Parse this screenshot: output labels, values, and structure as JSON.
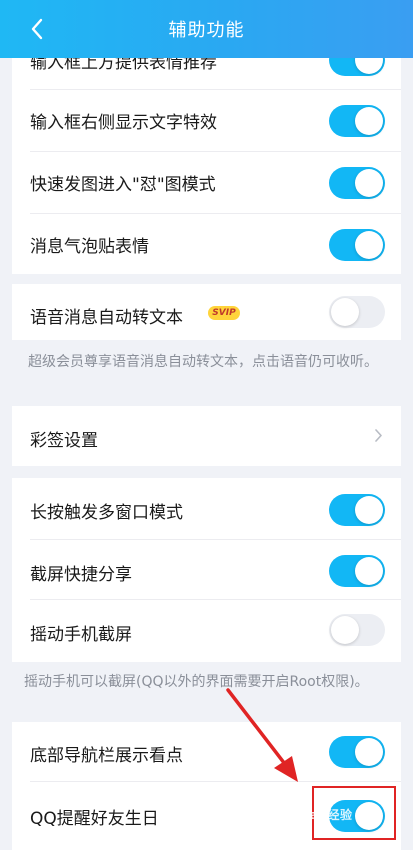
{
  "header": {
    "title": "辅助功能"
  },
  "card1": {
    "rows": [
      {
        "label": "输入框上方提供表情推荐",
        "on": true
      },
      {
        "label": "输入框右侧显示文字特效",
        "on": true
      },
      {
        "label": "快速发图进入\"怼\"图模式",
        "on": true
      },
      {
        "label": "消息气泡贴表情",
        "on": true
      }
    ]
  },
  "card2": {
    "label": "语音消息自动转文本",
    "badge": "SVIP",
    "on": false,
    "note": "超级会员尊享语音消息自动转文本，点击语音仍可收听。"
  },
  "card3": {
    "label": "彩签设置"
  },
  "card4": {
    "rows": [
      {
        "label": "长按触发多窗口模式",
        "on": true
      },
      {
        "label": "截屏快捷分享",
        "on": true
      },
      {
        "label": "摇动手机截屏",
        "on": false
      }
    ],
    "note": "摇动手机可以截屏(QQ以外的界面需要开启Root权限)。"
  },
  "card5": {
    "rows": [
      {
        "label": "底部导航栏展示看点",
        "on": true
      },
      {
        "label": "QQ提醒好友生日",
        "on": true
      }
    ]
  },
  "watermark": "Bai 经验",
  "colors": {
    "accent": "#12b7f5",
    "header": "#2aa8f2",
    "annotation": "#e02424"
  }
}
